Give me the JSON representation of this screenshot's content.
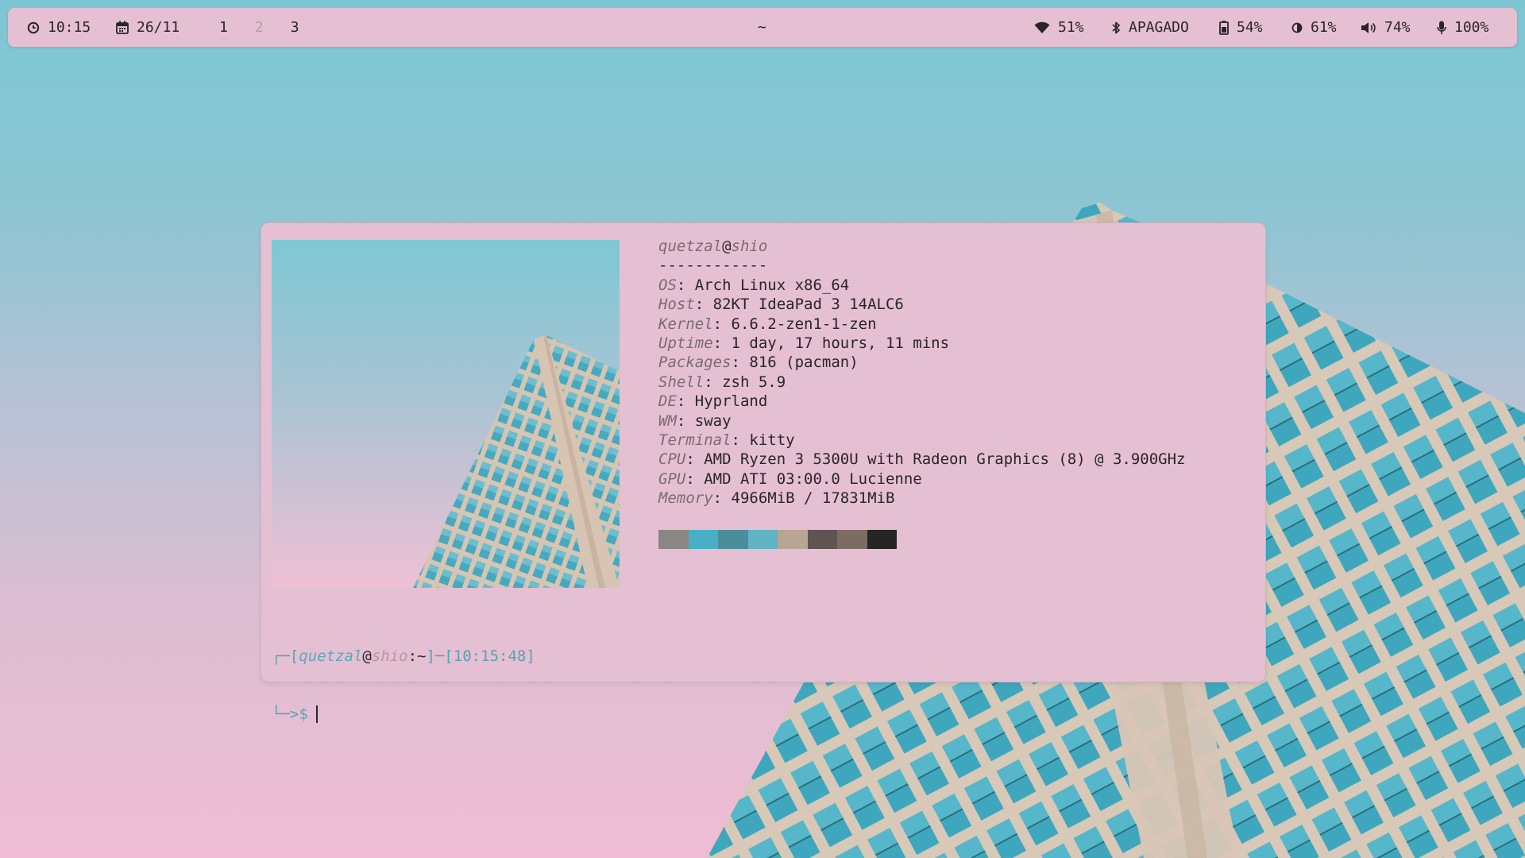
{
  "topbar": {
    "time": "10:15",
    "date": "26/11",
    "workspaces": [
      "1",
      "2",
      "3"
    ],
    "active_title": "~",
    "wifi": "51%",
    "bluetooth": "APAGADO",
    "battery": "54%",
    "brightness": "61%",
    "volume": "74%",
    "mic": "100%",
    "icons": {
      "time": "clock-icon",
      "date": "calendar-icon",
      "wifi": "wifi-icon",
      "bluetooth": "bluetooth-icon",
      "battery": "battery-icon",
      "brightness": "brightness-icon",
      "volume": "volume-icon",
      "mic": "microphone-icon"
    }
  },
  "fetch": {
    "user": "quetzal",
    "at": "@",
    "host": "shio",
    "separator": "------------",
    "rows": [
      {
        "key": "OS",
        "value": ": Arch Linux x86_64"
      },
      {
        "key": "Host",
        "value": ": 82KT IdeaPad 3 14ALC6"
      },
      {
        "key": "Kernel",
        "value": ": 6.6.2-zen1-1-zen"
      },
      {
        "key": "Uptime",
        "value": ": 1 day, 17 hours, 11 mins"
      },
      {
        "key": "Packages",
        "value": ": 816 (pacman)"
      },
      {
        "key": "Shell",
        "value": ": zsh 5.9"
      },
      {
        "key": "DE",
        "value": ": Hyprland"
      },
      {
        "key": "WM",
        "value": ": sway"
      },
      {
        "key": "Terminal",
        "value": ": kitty"
      },
      {
        "key": "CPU",
        "value": ": AMD Ryzen 3 5300U with Radeon Graphics (8) @ 3.900GHz"
      },
      {
        "key": "GPU",
        "value": ": AMD ATI 03:00.0 Lucienne"
      },
      {
        "key": "Memory",
        "value": ": 4966MiB / 17831MiB"
      }
    ],
    "palette": [
      "#8a8683",
      "#49afc4",
      "#4a8e9c",
      "#62b3c4",
      "#b8a594",
      "#5f5452",
      "#7d6c61",
      "#262424"
    ]
  },
  "prompt": {
    "line1_open": "┌─[",
    "user": "quetzal",
    "at": "@",
    "host": "shio",
    "sep": ":",
    "path": "~",
    "mid": "]─[",
    "time": "10:15:48",
    "close": "]",
    "line2_corner": "└─>",
    "dollar": "$"
  },
  "colors": {
    "bar_bg": "#e4c0d2",
    "terminal_bg": "#e4c0d2",
    "accent_cyan": "#5aa8be",
    "text": "#2a2528"
  }
}
